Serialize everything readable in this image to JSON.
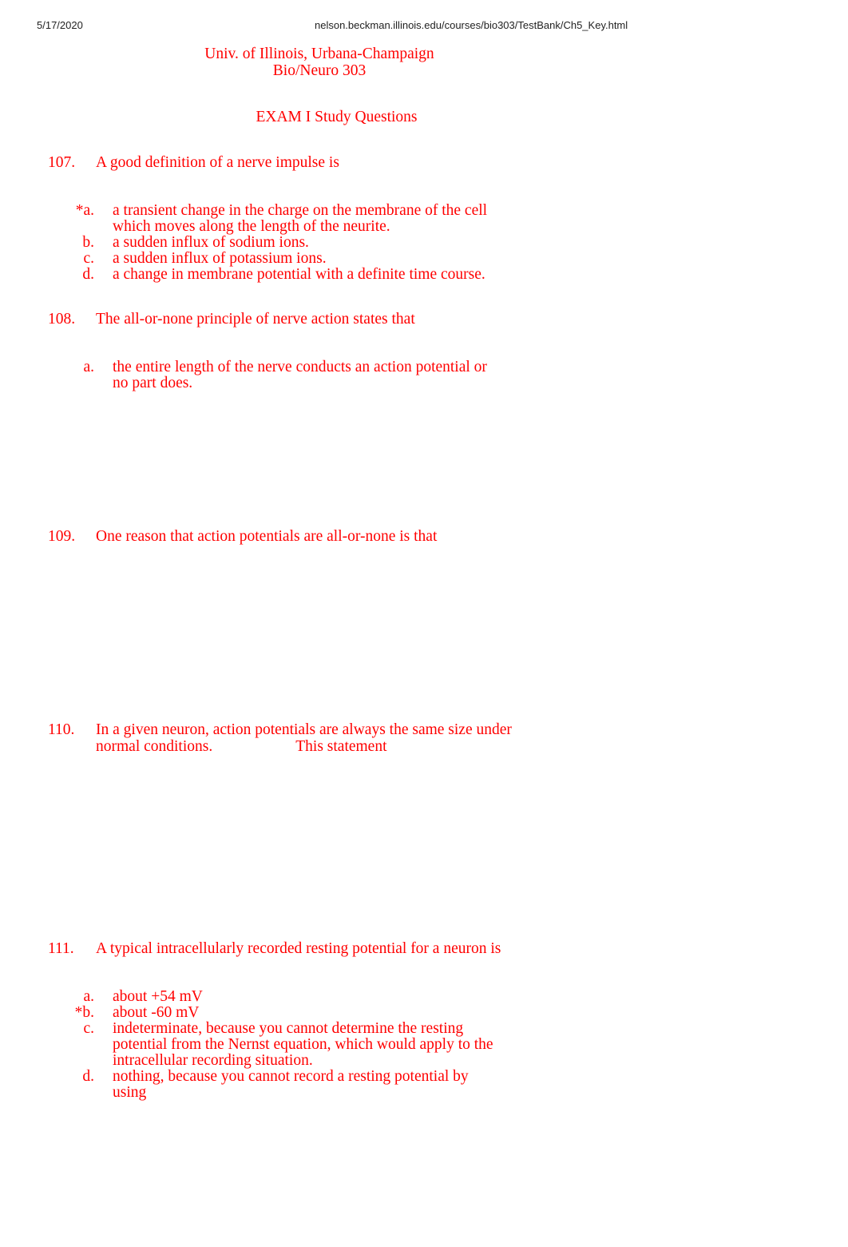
{
  "print_header": {
    "date": "5/17/2020",
    "url": "nelson.beckman.illinois.edu/courses/bio303/TestBank/Ch5_Key.html"
  },
  "institution": {
    "line1": "Univ. of Illinois, Urbana-Champaign",
    "line2": "Bio/Neuro 303"
  },
  "exam_title": "EXAM I Study Questions",
  "theme": {
    "text_color": "#ff0000",
    "header_color": "#222222",
    "background": "#ffffff"
  },
  "questions": [
    {
      "number": "107.",
      "stem": "A good definition of a nerve impulse is",
      "options": [
        {
          "letter": "*a.",
          "text": "a transient change in the charge on the membrane of the cell which moves along the length of the neurite."
        },
        {
          "letter": "b.",
          "text": "a sudden influx of sodium ions."
        },
        {
          "letter": "c.",
          "text": "a sudden influx of potassium ions."
        },
        {
          "letter": "d.",
          "text": "a change in membrane potential with a definite time course."
        }
      ]
    },
    {
      "number": "108.",
      "stem": "The all-or-none principle of nerve action states that",
      "options": [
        {
          "letter": "a.",
          "text": "the entire length of the nerve conducts an action potential or no part does."
        }
      ]
    },
    {
      "number": "109.",
      "stem": "One reason that action potentials are all-or-none is that",
      "options": []
    },
    {
      "number": "110.",
      "stem_part1": "In a given neuron, action potentials are always the same size under normal conditions.",
      "stem_part2": "This statement",
      "options": []
    },
    {
      "number": "111.",
      "stem": "A typical intracellularly recorded resting potential for a neuron is",
      "options": [
        {
          "letter": "a.",
          "text": "about +54 mV"
        },
        {
          "letter": "*b.",
          "text": "about -60 mV"
        },
        {
          "letter": "c.",
          "text": "indeterminate, because you cannot determine the resting potential from the Nernst equation, which would apply to the intracellular recording situation."
        },
        {
          "letter": "d.",
          "text": "nothing, because you cannot record a resting potential by using"
        }
      ]
    }
  ]
}
